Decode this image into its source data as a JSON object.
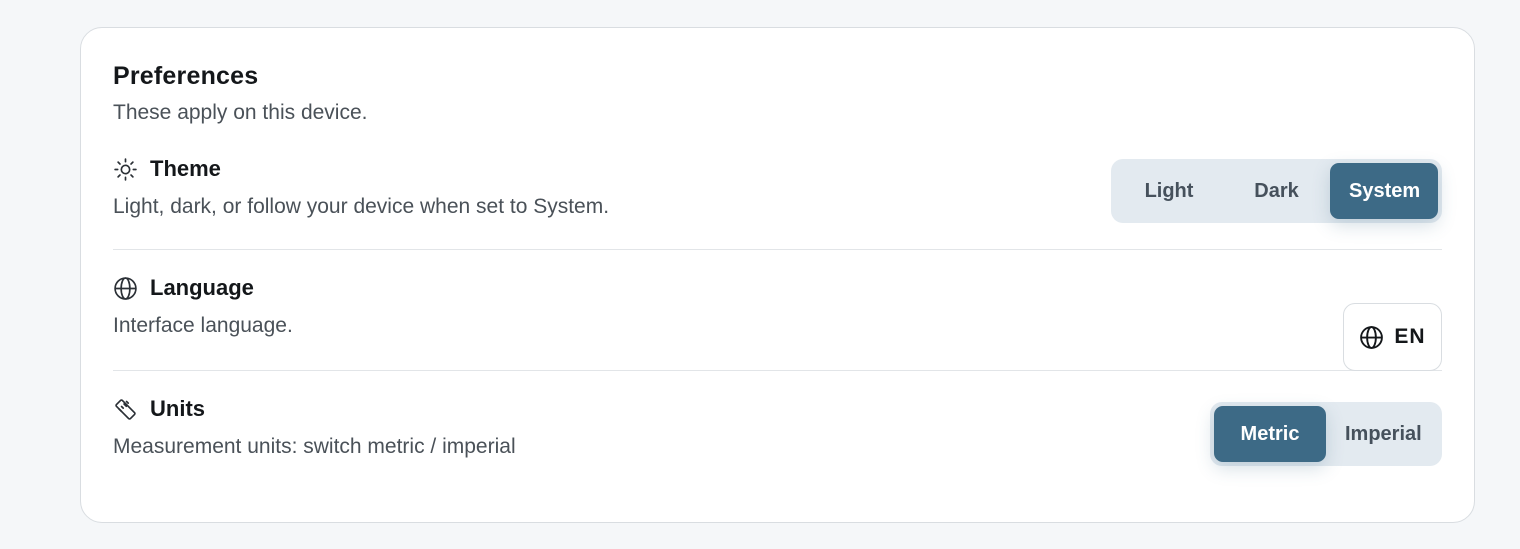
{
  "card": {
    "title": "Preferences",
    "subtitle": "These apply on this device."
  },
  "theme": {
    "icon": "sun-icon",
    "label": "Theme",
    "description": "Light, dark, or follow your device when set to System.",
    "options": [
      "Light",
      "Dark",
      "System"
    ],
    "selected": "System"
  },
  "language": {
    "icon": "globe-icon",
    "label": "Language",
    "description": "Interface language.",
    "button_icon": "globe-icon",
    "current_code": "EN"
  },
  "units": {
    "icon": "ruler-icon",
    "label": "Units",
    "description": "Measurement units: switch metric / imperial",
    "options": [
      "Metric",
      "Imperial"
    ],
    "selected": "Metric"
  },
  "colors": {
    "accent": "#3d6a86",
    "segment_track": "#e3eaf0",
    "card_border": "#d9dde1"
  }
}
